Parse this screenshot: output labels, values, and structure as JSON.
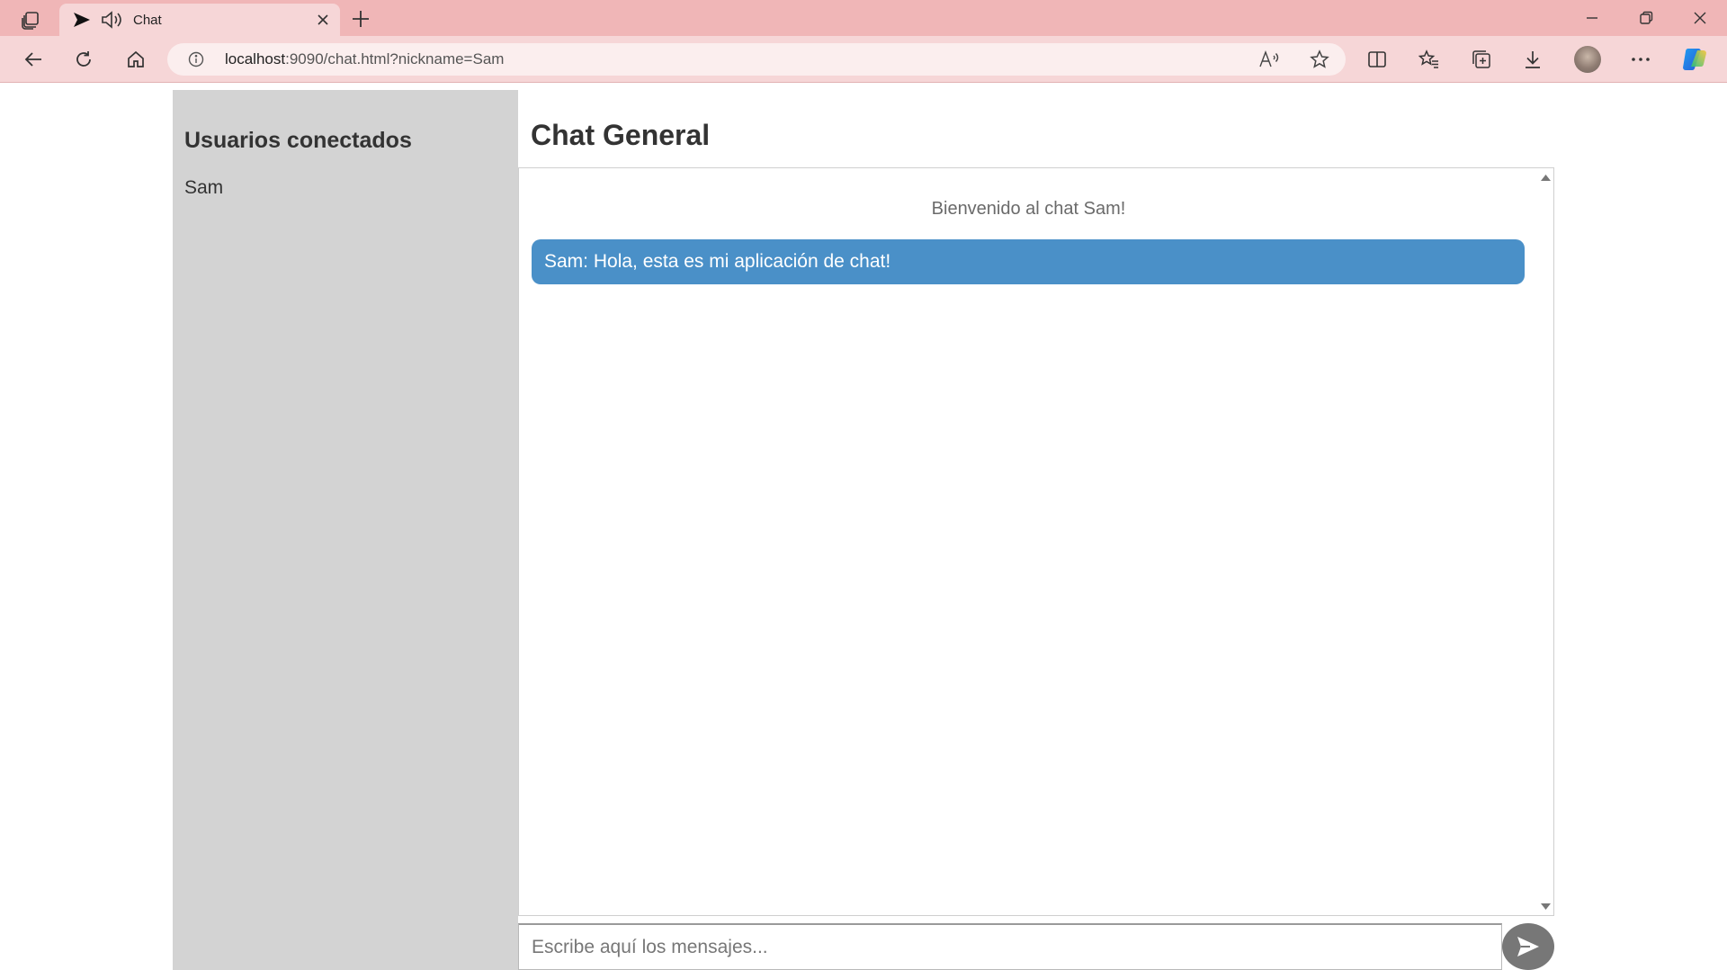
{
  "browser": {
    "tab": {
      "title": "Chat"
    },
    "address_bar": {
      "url_host": "localhost",
      "url_rest": ":9090/chat.html?nickname=Sam"
    },
    "icons": {
      "tab_actions": "tab-actions-icon",
      "play": "play-icon",
      "speaker": "speaker-icon",
      "close_tab": "close-icon",
      "new_tab": "plus-icon",
      "minimize": "minimize-icon",
      "restore": "restore-icon",
      "close_window": "close-icon",
      "back": "back-arrow-icon",
      "refresh": "refresh-icon",
      "home": "home-icon",
      "info": "info-icon",
      "read_aloud": "read-aloud-icon",
      "favorite": "star-icon",
      "split_screen": "split-screen-icon",
      "favorites": "favorites-icon",
      "collections": "collections-icon",
      "downloads": "download-icon",
      "profile": "avatar",
      "more": "more-icon",
      "copilot": "copilot-icon"
    }
  },
  "sidebar": {
    "title": "Usuarios conectados",
    "users": [
      "Sam"
    ]
  },
  "chat": {
    "title": "Chat General",
    "welcome": "Bienvenido al chat Sam!",
    "messages": [
      {
        "text": "Sam: Hola, esta es mi aplicación de chat!"
      }
    ],
    "input_placeholder": "Escribe aquí los mensajes...",
    "input_value": ""
  },
  "colors": {
    "tabbar": "#f0b6b7",
    "toolbar": "#f6d6d7",
    "sidebar": "#d3d3d3",
    "message_bubble": "#4a90c8",
    "send_button": "#777777"
  }
}
